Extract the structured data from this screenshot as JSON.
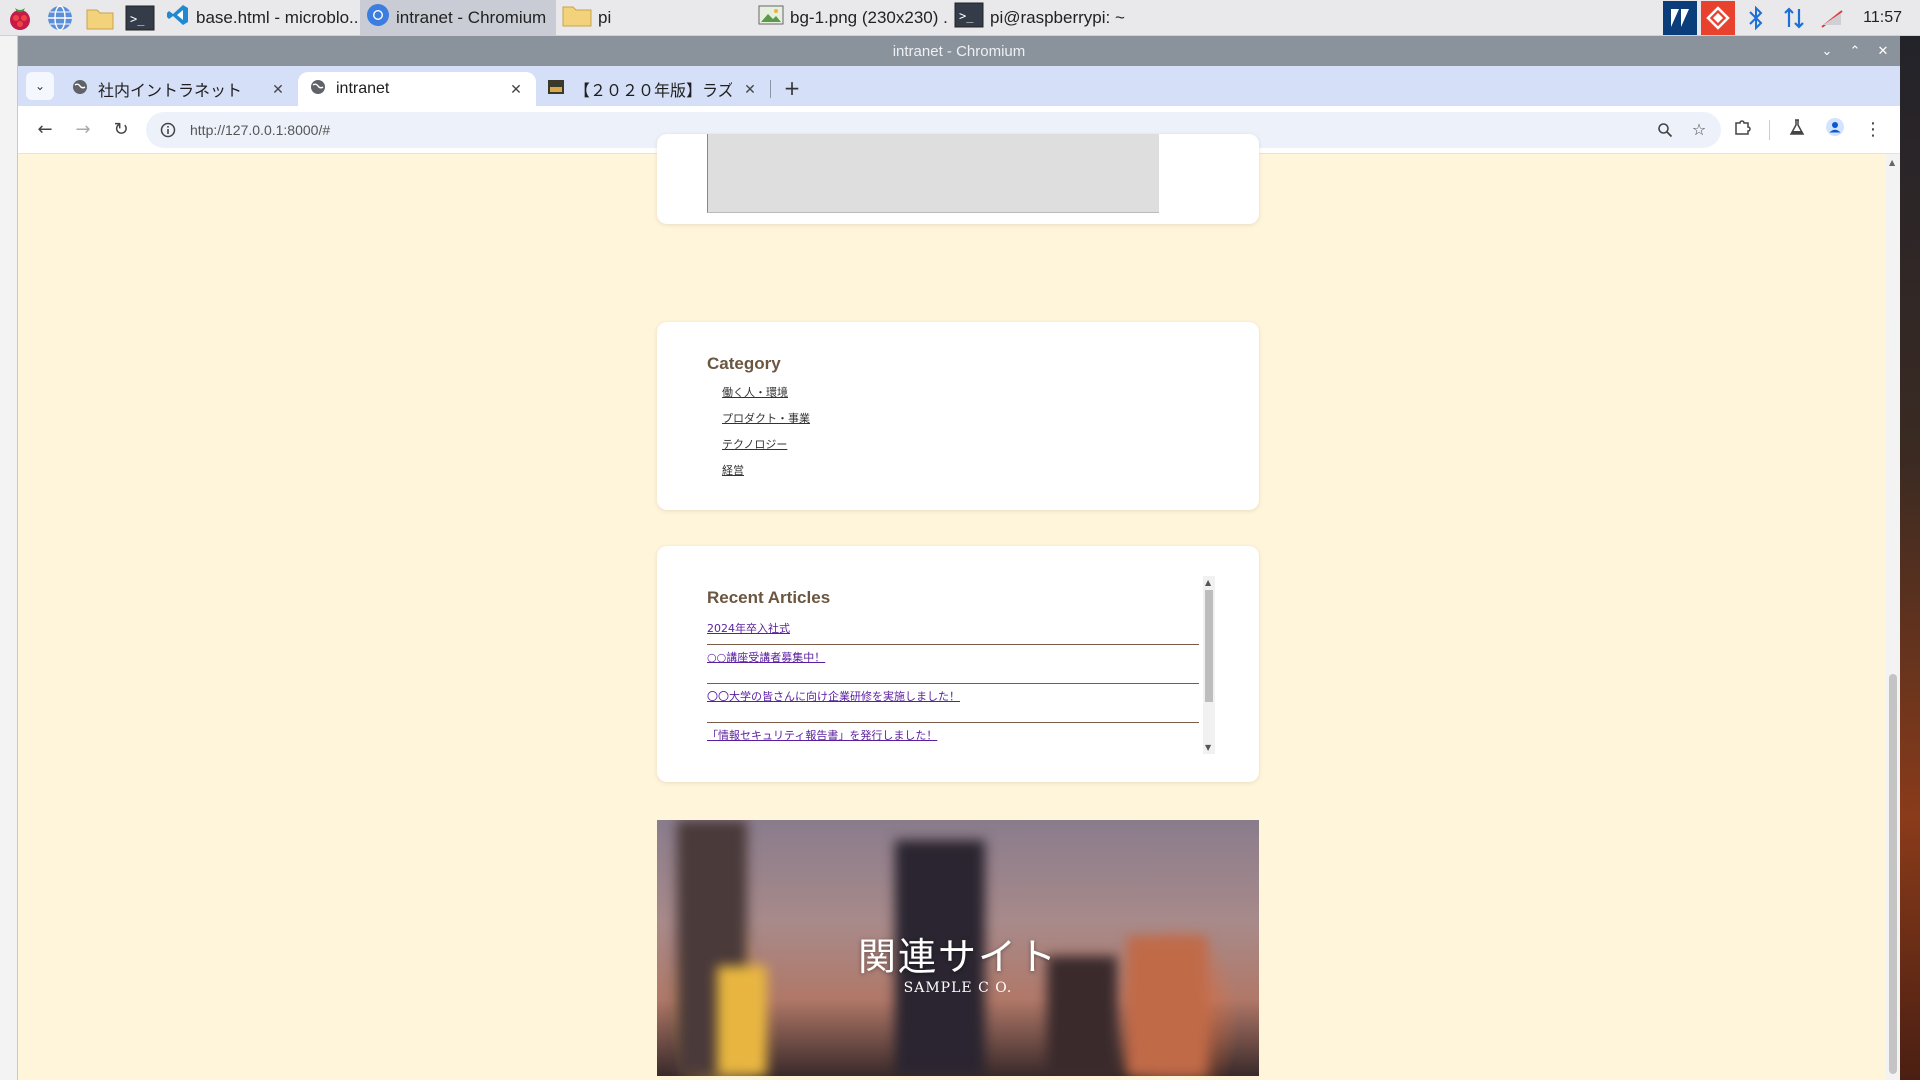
{
  "taskbar": {
    "tasks": [
      {
        "label": "base.html - microblo...",
        "icon": "vscode-icon"
      },
      {
        "label": "intranet - Chromium",
        "icon": "chromium-icon"
      },
      {
        "label": "pi",
        "icon": "folder-icon"
      },
      {
        "label": "bg-1.png (230x230) ...",
        "icon": "image-viewer-icon"
      },
      {
        "label": "pi@raspberrypi: ~",
        "icon": "terminal-icon"
      }
    ],
    "clock": "11:57"
  },
  "browser": {
    "window_title": "intranet - Chromium",
    "tabs": [
      {
        "title": "社内イントラネット"
      },
      {
        "title": "intranet"
      },
      {
        "title": "【２０２０年版】ラズ"
      }
    ],
    "url": "http://127.0.0.1:8000/#"
  },
  "page": {
    "category": {
      "heading": "Category",
      "items": [
        "働く人・環境",
        "プロダクト・事業",
        "テクノロジー",
        "経営"
      ]
    },
    "recent": {
      "heading": "Recent Articles",
      "items": [
        "2024年卒入社式",
        "○○講座受講者募集中！",
        "〇〇大学の皆さんに向け企業研修を実施しました！",
        "「情報セキュリティ報告書」を発行しました！"
      ]
    },
    "related": {
      "title": "関連サイト",
      "subtitle": "SAMPLE C O."
    }
  },
  "colors": {
    "page_bg": "#fff5db",
    "heading": "#6b5640",
    "link_visited": "#5a1ea0",
    "tabstrip": "#d5e0f8"
  }
}
